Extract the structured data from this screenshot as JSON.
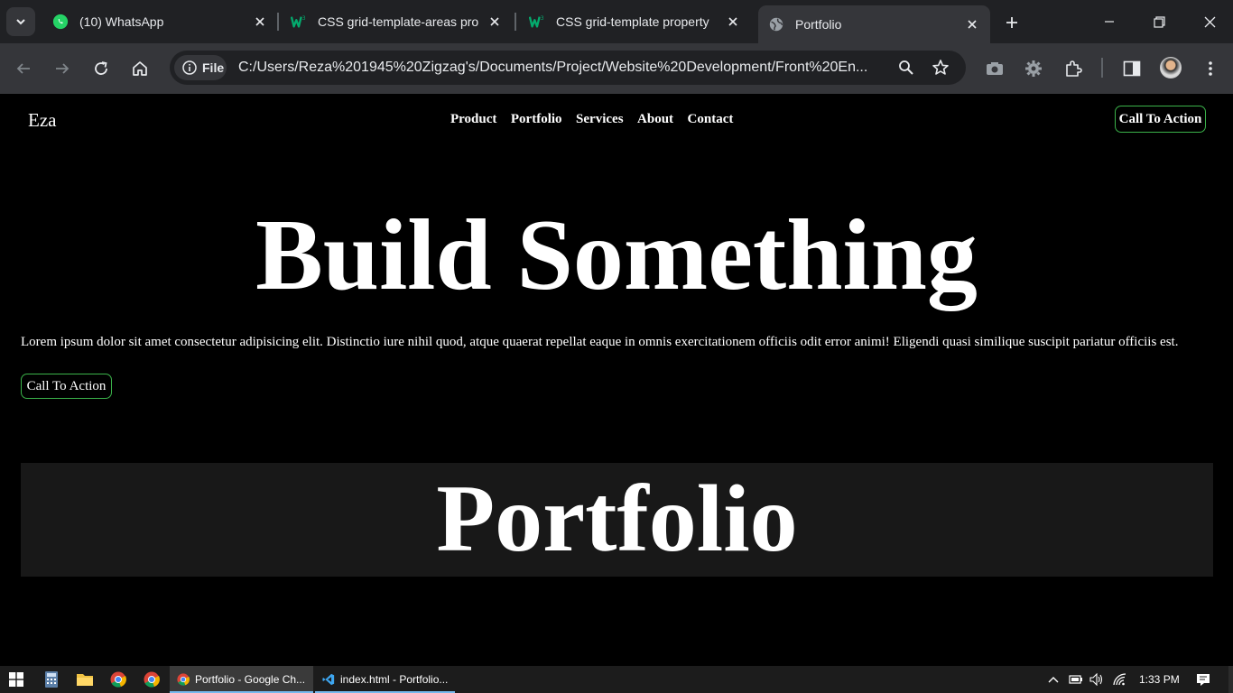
{
  "browser": {
    "tabs": [
      {
        "title": "(10) WhatsApp",
        "favicon": "whatsapp-icon"
      },
      {
        "title": "CSS grid-template-areas pro",
        "favicon": "w3schools-icon"
      },
      {
        "title": "CSS grid-template property",
        "favicon": "w3schools-icon"
      },
      {
        "title": "Portfolio",
        "favicon": "globe-icon",
        "active": true
      }
    ],
    "security_chip": "File",
    "url": "C:/Users/Reza%201945%20Zigzag's/Documents/Project/Website%20Development/Front%20En...",
    "colors": {
      "tabstrip": "#202124",
      "toolbar": "#35363a",
      "omnibox": "#202124"
    }
  },
  "page": {
    "logo": "Eza",
    "nav": [
      "Product",
      "Portfolio",
      "Services",
      "About",
      "Contact"
    ],
    "cta_top": "Call To Action",
    "hero_title": "Build Something",
    "hero_text": "Lorem ipsum dolor sit amet consectetur adipisicing elit. Distinctio iure nihil quod, atque quaerat repellat eaque in omnis exercitationem officiis odit error animi! Eligendi quasi similique suscipit pariatur officiis est.",
    "cta_hero": "Call To Action",
    "section_title": "Portfolio",
    "colors": {
      "background": "#000000",
      "text": "#ffffff",
      "cta_border": "#3bb34a",
      "section_bg": "#181818"
    }
  },
  "taskbar": {
    "apps": [
      {
        "label": "Portfolio - Google Ch...",
        "icon": "chrome-icon",
        "active": true
      },
      {
        "label": "index.html - Portfolio...",
        "icon": "vscode-icon"
      }
    ],
    "pinned": [
      "windows-start-icon",
      "calculator-icon",
      "file-explorer-icon",
      "chrome-icon",
      "chrome-icon"
    ],
    "tray": [
      "chevron-up-icon",
      "battery-icon",
      "volume-icon",
      "wifi-icon"
    ],
    "time": "1:33 PM",
    "notification_icon": "notification-icon"
  }
}
